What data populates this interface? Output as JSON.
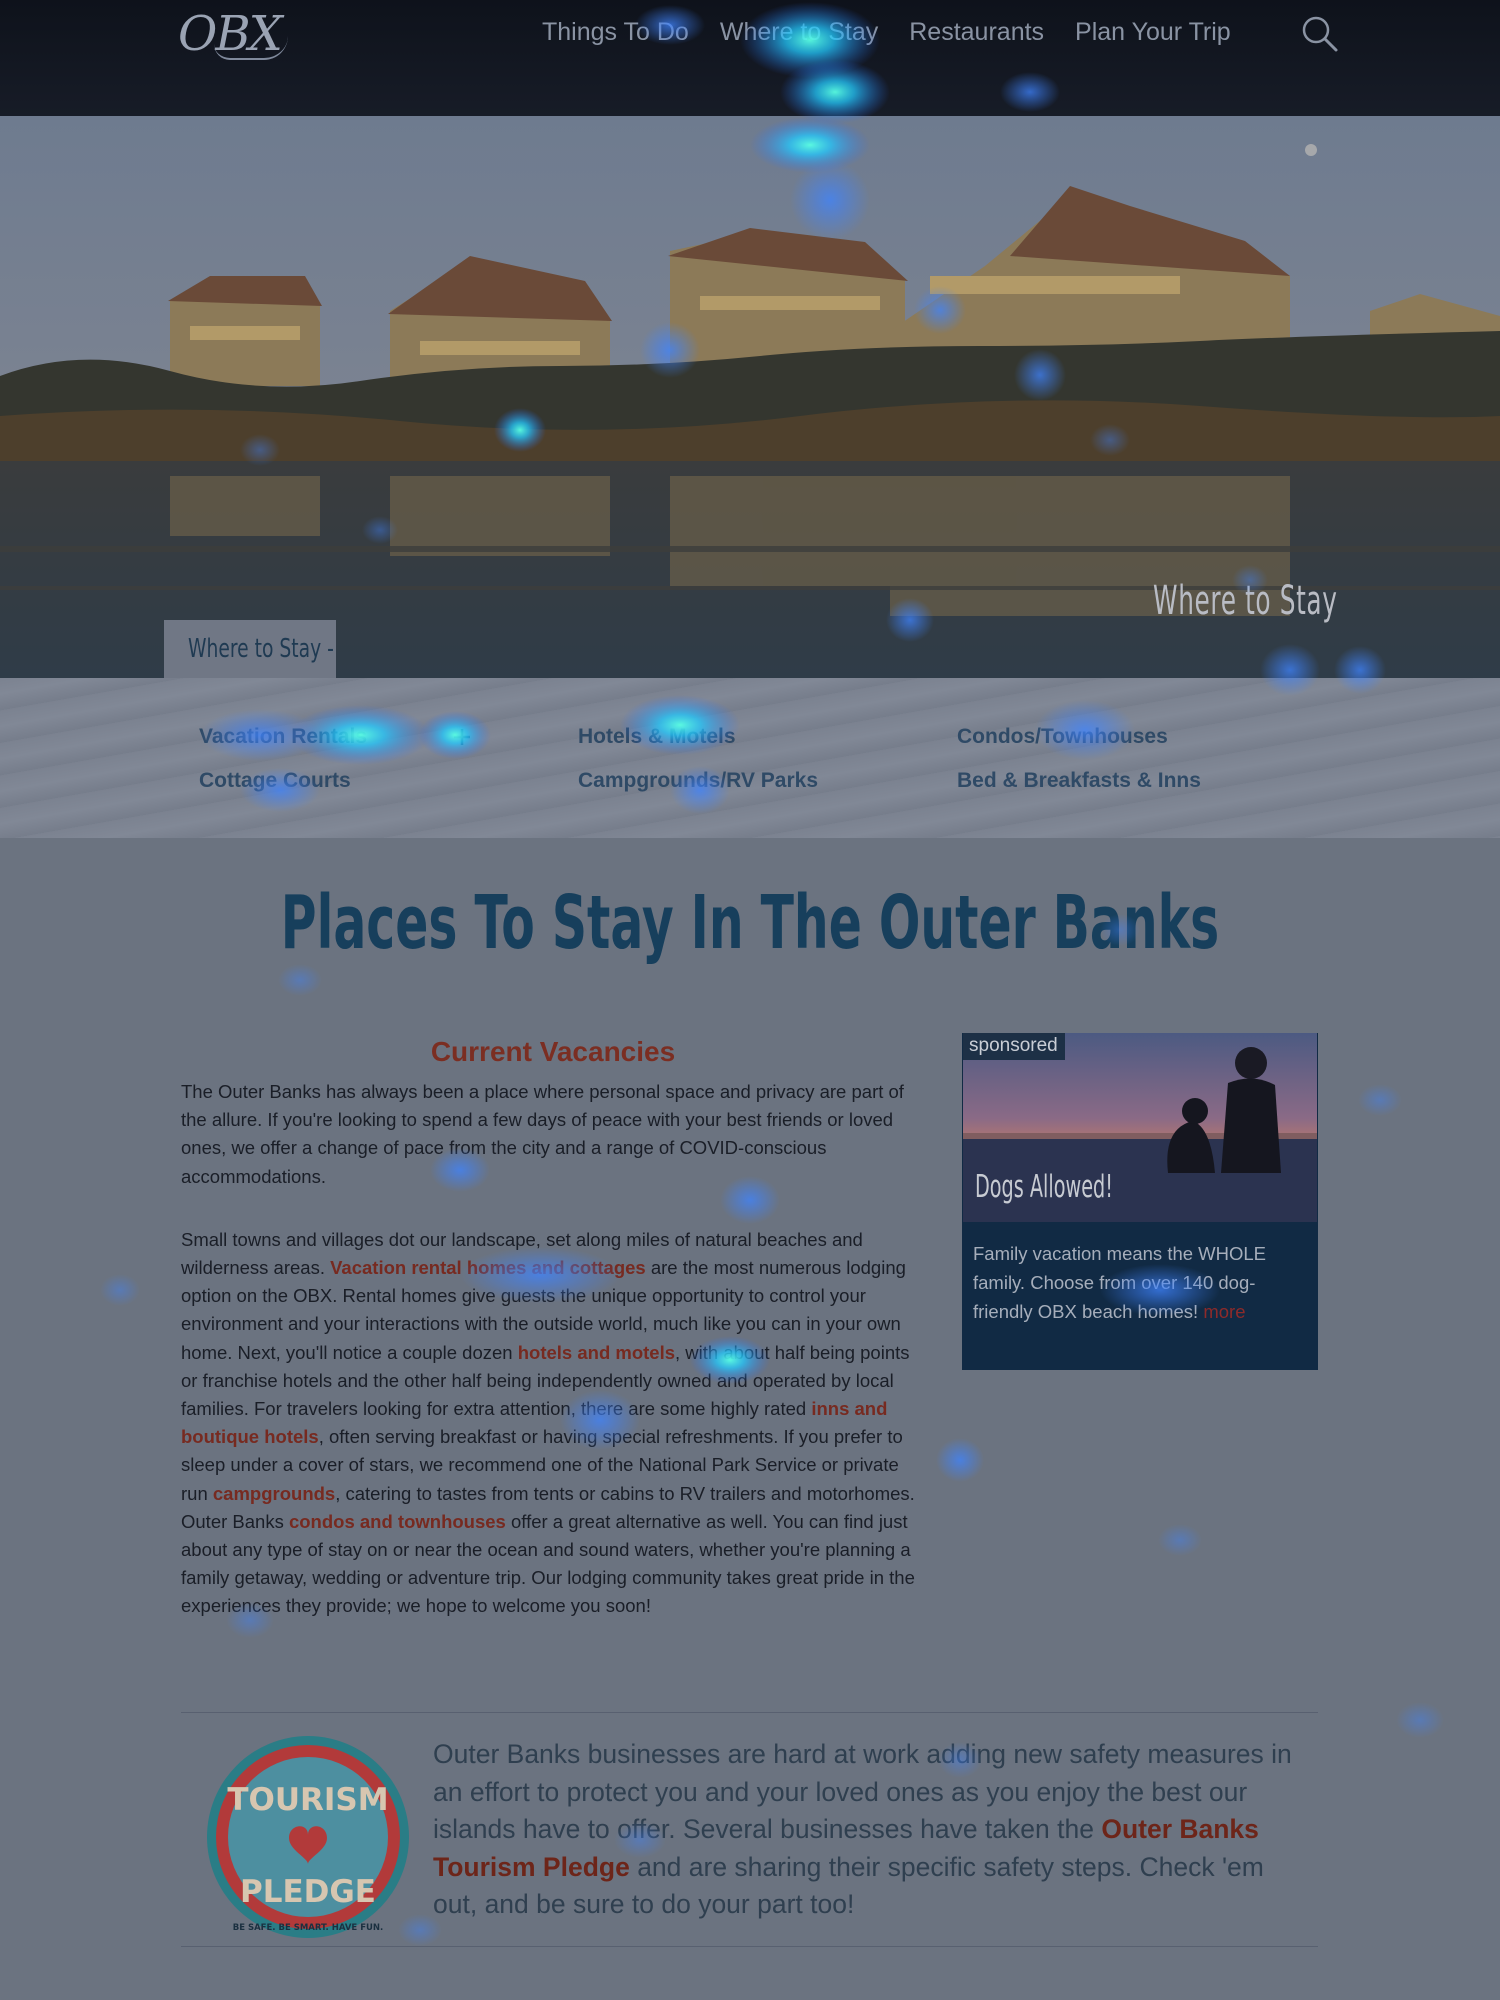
{
  "header": {
    "logo": "OBX",
    "nav": [
      {
        "label": "Things To Do"
      },
      {
        "label": "Where to Stay"
      },
      {
        "label": "Restaurants"
      },
      {
        "label": "Plan Your Trip"
      }
    ],
    "search_icon": "search-icon"
  },
  "hero": {
    "caption": "Where to Stay",
    "tab": "Where to Stay -"
  },
  "subnav": {
    "links": [
      {
        "label": "Vacation Rentals"
      },
      {
        "label": "Hotels & Motels"
      },
      {
        "label": "Condos/Townhouses"
      },
      {
        "label": "Cottage Courts"
      },
      {
        "label": "Campgrounds/RV Parks"
      },
      {
        "label": "Bed & Breakfasts & Inns"
      }
    ],
    "expand_icon": "plus-icon"
  },
  "main": {
    "title": "Places To Stay In The Outer Banks",
    "article": {
      "heading": "Current Vacancies",
      "p1": "The Outer Banks has always been a place where personal space and privacy are part of the allure. If you're looking to spend a few days of peace with your best friends or loved ones, we offer a change of pace from the city and a range of COVID-conscious accommodations.",
      "p2": {
        "t1": "Small towns and villages dot our landscape, set along miles of natural beaches and wilderness areas. ",
        "l1": "Vacation rental homes and cottages",
        "t2": " are the most numerous lodging option on the OBX. Rental homes give guests the unique opportunity to control your environment and your interactions with the outside world, much like you can in your own home. Next, you'll notice a couple dozen ",
        "l2": "hotels and motels",
        "t3": ", with about half being points or franchise hotels and the other half being independently owned and operated by local families. For travelers looking for extra attention, there are some highly rated ",
        "l3": "inns and boutique hotels",
        "t4": ", often serving breakfast or having special refreshments. If you prefer to sleep under a cover of stars, we recommend one of the National Park Service or private run ",
        "l4": "campgrounds",
        "t5": ", catering to tastes from tents or cabins to RV trailers and motorhomes. Outer Banks ",
        "l5": "condos and townhouses",
        "t6": " offer a great alternative as well. You can find just about any type of stay on or near the ocean and sound waters, whether you're planning a family getaway, wedding or adventure trip. Our lodging community takes great pride in the experiences they provide; we hope to welcome you soon!"
      }
    },
    "ad": {
      "badge": "sponsored",
      "image_caption": "Dogs Allowed!",
      "text": "Family vacation means the WHOLE family. Choose from over 140 dog-friendly OBX beach homes!",
      "more_link": "more"
    },
    "pledge": {
      "badge_text_top": "TOURISM",
      "badge_text_bottom": "PLEDGE",
      "badge_ring": "BE SAFE. BE SMART. HAVE FUN.",
      "t1": "Outer Banks businesses are hard at work adding new safety measures in an effort to protect you and your loved ones as you enjoy the best our islands have to offer. Several businesses have taken the ",
      "link": "Outer Banks Tourism Pledge",
      "t2": " and are sharing their specific safety steps. Check 'em out, and be sure to do your part too!"
    }
  },
  "colors": {
    "link_red": "#772a20",
    "navy": "#173f5c",
    "heat_blue": "#2f6fff",
    "heat_cyan": "#2ef0ff"
  }
}
